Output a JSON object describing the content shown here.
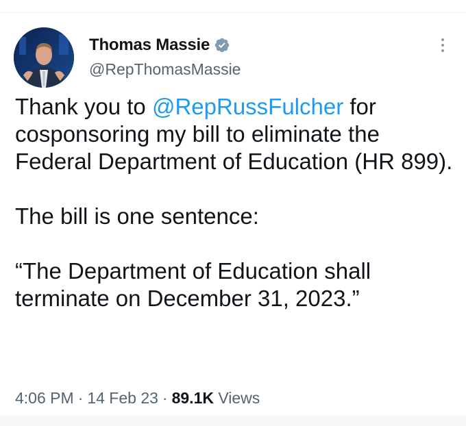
{
  "tweet": {
    "author": {
      "display_name": "Thomas Massie",
      "handle": "@RepThomasMassie",
      "verified": true
    },
    "text": {
      "p1_before": "Thank you to ",
      "p1_mention": "@RepRussFulcher",
      "p1_after": " for cosponsoring my bill to eliminate the Federal Department of Education (HR 899).",
      "p2": "The bill is one sentence:",
      "p3": "“The Department of Education shall terminate on December 31, 2023.”"
    },
    "meta": {
      "time": "4:06 PM",
      "separator": "·",
      "date": "14 Feb 23",
      "views_count": "89.1K",
      "views_label": "Views"
    }
  },
  "colors": {
    "text": "#0f1419",
    "secondary": "#536471",
    "link": "#1d9bf0",
    "verified_badge": "#829aab"
  },
  "icons": {
    "verified": "verified-badge-icon",
    "more": "more-options-icon"
  }
}
